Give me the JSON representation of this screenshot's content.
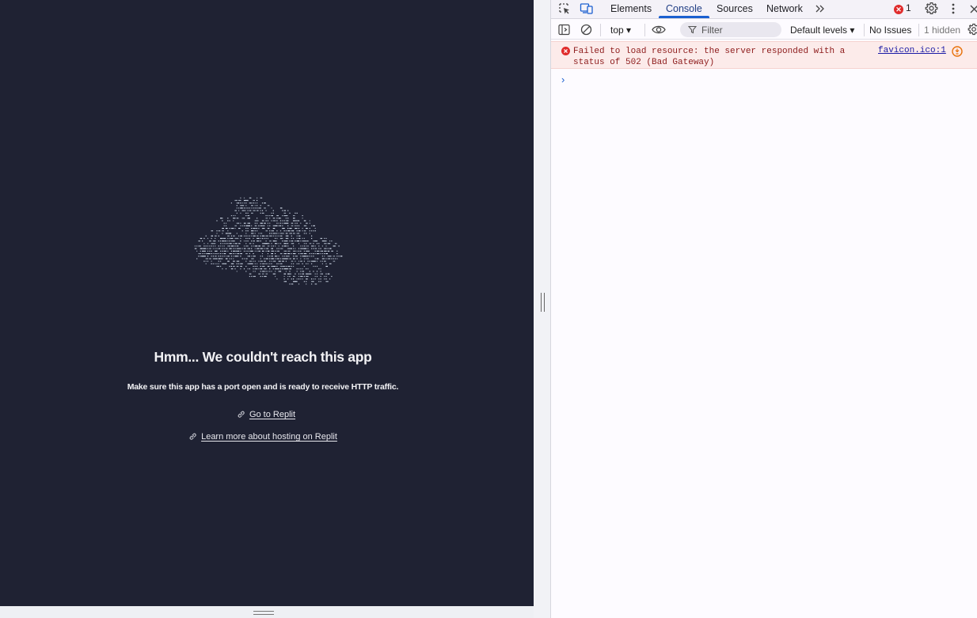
{
  "app": {
    "error_title": "Hmm... We couldn't reach this app",
    "error_subtitle": "Make sure this app has a port open and is ready to receive HTTP traffic.",
    "links": [
      {
        "label": "Go to Replit",
        "icon": "link-icon"
      },
      {
        "label": "Learn more about hosting on Replit",
        "icon": "link-icon"
      }
    ],
    "background_color": "#1f2233"
  },
  "devtools": {
    "tabs": [
      {
        "label": "Elements"
      },
      {
        "label": "Console",
        "active": true
      },
      {
        "label": "Sources"
      },
      {
        "label": "Network"
      }
    ],
    "error_count": "1",
    "toolbar": {
      "context": "top",
      "filter_placeholder": "Filter",
      "levels": "Default levels",
      "issues": "No Issues",
      "hidden": "1 hidden"
    },
    "messages": [
      {
        "level": "error",
        "text": "Failed to load resource: the server responded with a\nstatus of 502 (Bad Gateway)",
        "source": "favicon.ico:1"
      }
    ],
    "accent_color": "#1a5fd0",
    "error_color": "#e02c2c"
  }
}
